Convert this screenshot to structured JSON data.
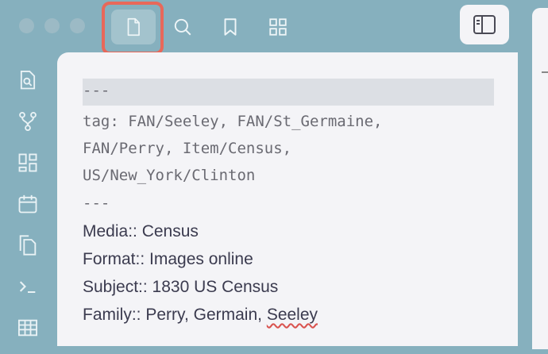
{
  "top_tabs": [
    {
      "name": "file-explorer",
      "icon": "file-icon",
      "active": true
    },
    {
      "name": "search",
      "icon": "search-icon",
      "active": false
    },
    {
      "name": "bookmarks",
      "icon": "bookmark-icon",
      "active": false
    },
    {
      "name": "dashboard",
      "icon": "grid-icon",
      "active": false
    }
  ],
  "ribbon_icons": [
    "search-file-icon",
    "graph-icon",
    "dashboard-icon",
    "calendar-icon",
    "copy-icon",
    "terminal-icon",
    "table-icon"
  ],
  "editor": {
    "frontmatter_start": "---",
    "tag_line1": "tag: FAN/Seeley, FAN/St_Germaine,",
    "tag_line2": "FAN/Perry, Item/Census,",
    "tag_line3": "US/New_York/Clinton",
    "frontmatter_end": "---",
    "media": "Media::  Census",
    "format": "Format:: Images online",
    "subject": "Subject::  1830 US Census",
    "family_prefix": "Family:: Perry, Germain, ",
    "family_last": "Seeley"
  },
  "colors": {
    "background": "#86b0be",
    "editor_bg": "#f4f4f7",
    "highlight": "#e8685a"
  }
}
